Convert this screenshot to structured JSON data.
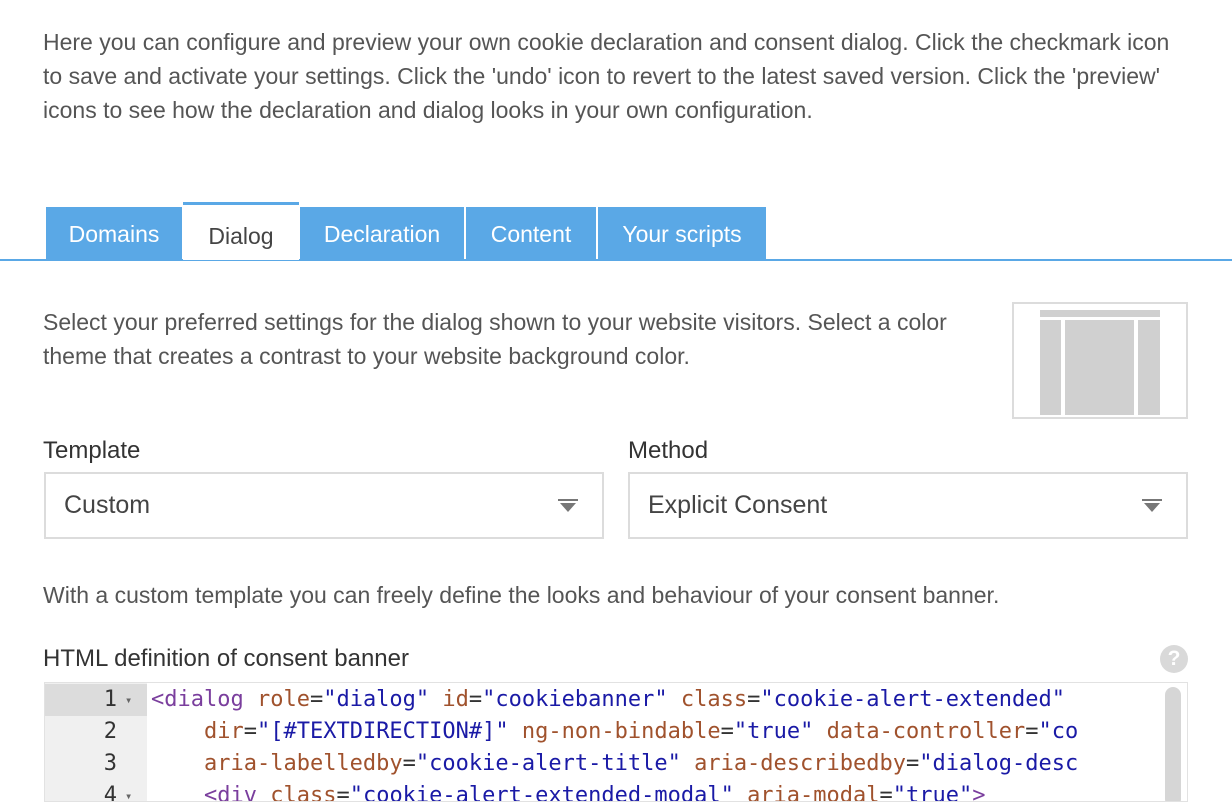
{
  "intro": {
    "text": "Here you can configure and preview your own cookie declaration and consent dialog. Click the checkmark icon to save and activate your settings. Click the 'undo' icon to revert to the latest saved version. Click the 'preview' icons to see how the declaration and dialog looks in your own configuration."
  },
  "tabs": [
    {
      "label": "Domains"
    },
    {
      "label": "Dialog"
    },
    {
      "label": "Declaration"
    },
    {
      "label": "Content"
    },
    {
      "label": "Your scripts"
    }
  ],
  "active_tab": "Dialog",
  "dialog": {
    "description": "Select your preferred settings for the dialog shown to your website visitors. Select a color theme that creates a contrast to your website background color.",
    "template_label": "Template",
    "template_value": "Custom",
    "method_label": "Method",
    "method_value": "Explicit Consent",
    "custom_note": "With a custom template you can freely define the looks and behaviour of your consent banner.",
    "editor_label": "HTML definition of consent banner",
    "help_glyph": "?"
  },
  "editor": {
    "lines": [
      {
        "number": "1",
        "fold": true,
        "segments": [
          [
            "tag",
            "<dialog"
          ],
          [
            "plain",
            " "
          ],
          [
            "attr",
            "role"
          ],
          [
            "plain",
            "="
          ],
          [
            "str",
            "\"dialog\""
          ],
          [
            "plain",
            " "
          ],
          [
            "attr",
            "id"
          ],
          [
            "plain",
            "="
          ],
          [
            "str",
            "\"cookiebanner\""
          ],
          [
            "plain",
            " "
          ],
          [
            "attr",
            "class"
          ],
          [
            "plain",
            "="
          ],
          [
            "str",
            "\"cookie-alert-extended\""
          ]
        ]
      },
      {
        "number": "2",
        "fold": false,
        "segments": [
          [
            "plain",
            "    "
          ],
          [
            "attr",
            "dir"
          ],
          [
            "plain",
            "="
          ],
          [
            "str",
            "\"[#TEXTDIRECTION#]\""
          ],
          [
            "plain",
            " "
          ],
          [
            "attr",
            "ng-non-bindable"
          ],
          [
            "plain",
            "="
          ],
          [
            "str",
            "\"true\""
          ],
          [
            "plain",
            " "
          ],
          [
            "attr",
            "data-controller"
          ],
          [
            "plain",
            "="
          ],
          [
            "str",
            "\"co"
          ]
        ]
      },
      {
        "number": "3",
        "fold": false,
        "segments": [
          [
            "plain",
            "    "
          ],
          [
            "attr",
            "aria-labelledby"
          ],
          [
            "plain",
            "="
          ],
          [
            "str",
            "\"cookie-alert-title\""
          ],
          [
            "plain",
            " "
          ],
          [
            "attr",
            "aria-describedby"
          ],
          [
            "plain",
            "="
          ],
          [
            "str",
            "\"dialog-desc"
          ]
        ]
      },
      {
        "number": "4",
        "fold": true,
        "segments": [
          [
            "plain",
            "    "
          ],
          [
            "tag",
            "<div"
          ],
          [
            "plain",
            " "
          ],
          [
            "attr",
            "class"
          ],
          [
            "plain",
            "="
          ],
          [
            "str",
            "\"cookie-alert-extended-modal\""
          ],
          [
            "plain",
            " "
          ],
          [
            "attr",
            "aria-modal"
          ],
          [
            "plain",
            "="
          ],
          [
            "str",
            "\"true\""
          ],
          [
            "tag",
            ">"
          ]
        ]
      }
    ]
  },
  "colors": {
    "accent": "#5aa8e6",
    "tab_text_active": "#444444",
    "tag": "#7a3e9d",
    "attr": "#a0522d",
    "string": "#1a1aa6"
  },
  "icons": {
    "select_caret": "caret-down-icon",
    "help": "question-mark-icon",
    "fold": "fold-arrow-icon"
  }
}
